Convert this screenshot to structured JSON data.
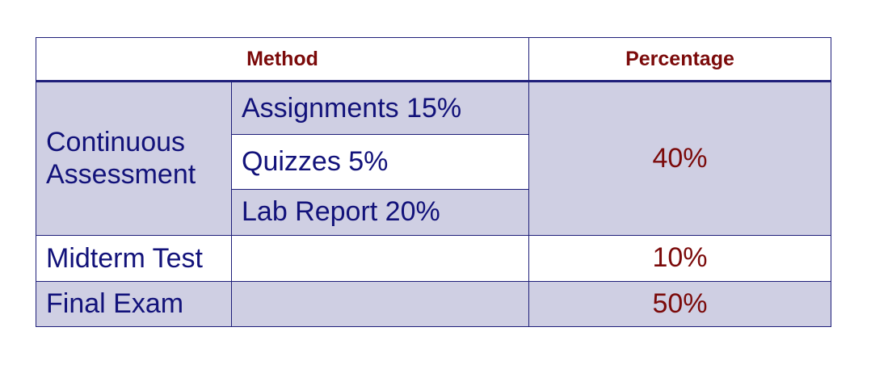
{
  "table": {
    "headers": {
      "method": "Method",
      "percentage": "Percentage"
    },
    "continuous_assessment": {
      "label_line1": "Continuous",
      "label_line2": "Assessment",
      "components": [
        "Assignments 15%",
        "Quizzes 5%",
        "Lab Report 20%"
      ],
      "percentage": "40%"
    },
    "midterm": {
      "label": "Midterm Test",
      "component": "",
      "percentage": "10%"
    },
    "final": {
      "label": "Final Exam",
      "component": "",
      "percentage": "50%"
    }
  },
  "colors": {
    "border": "#1f1f7a",
    "shaded_row": "#cfcfe3",
    "header_text": "#7b0a0a",
    "body_text": "#12127a",
    "percentage_text": "#7b0a0a"
  }
}
